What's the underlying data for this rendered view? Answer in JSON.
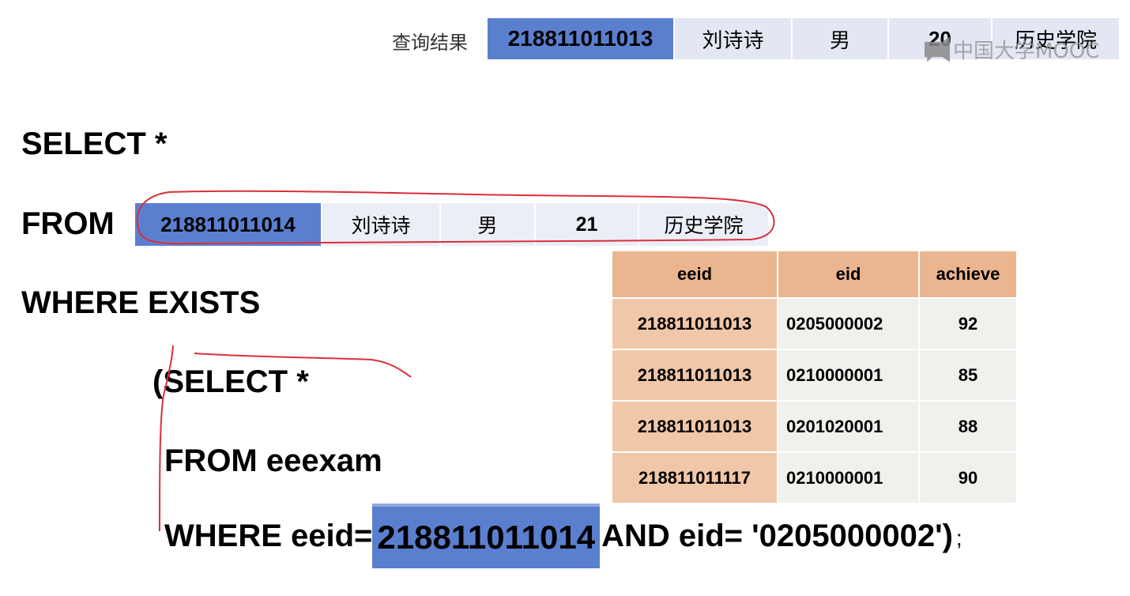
{
  "result": {
    "label": "查询结果",
    "cells": [
      "218811011013",
      "刘诗诗",
      "男",
      "20",
      "历史学院"
    ]
  },
  "watermark": {
    "text": "中国大学MOOC"
  },
  "sql": {
    "select": "SELECT  *",
    "from": "FROM",
    "from_row": [
      "218811011014",
      "刘诗诗",
      "男",
      "21",
      "历史学院"
    ],
    "where_exists": "WHERE EXISTS",
    "sub_select": "(SELECT  *",
    "sub_from": "FROM eeexam",
    "sub_where_prefix": "WHERE eeid=",
    "sub_where_value": "218811011014",
    "sub_where_suffix": "AND eid= '0205000002')",
    "semicolon": ";"
  },
  "exam_table": {
    "headers": [
      "eeid",
      "eid",
      "achieve"
    ],
    "rows": [
      [
        "218811011013",
        "0205000002",
        "92"
      ],
      [
        "218811011013",
        "0210000001",
        "85"
      ],
      [
        "218811011013",
        "0201020001",
        "88"
      ],
      [
        "218811011117",
        "0210000001",
        "90"
      ]
    ]
  },
  "colors": {
    "highlight": "#5b7fcf",
    "annotation": "#d9303a",
    "table_header": "#eab58f"
  }
}
